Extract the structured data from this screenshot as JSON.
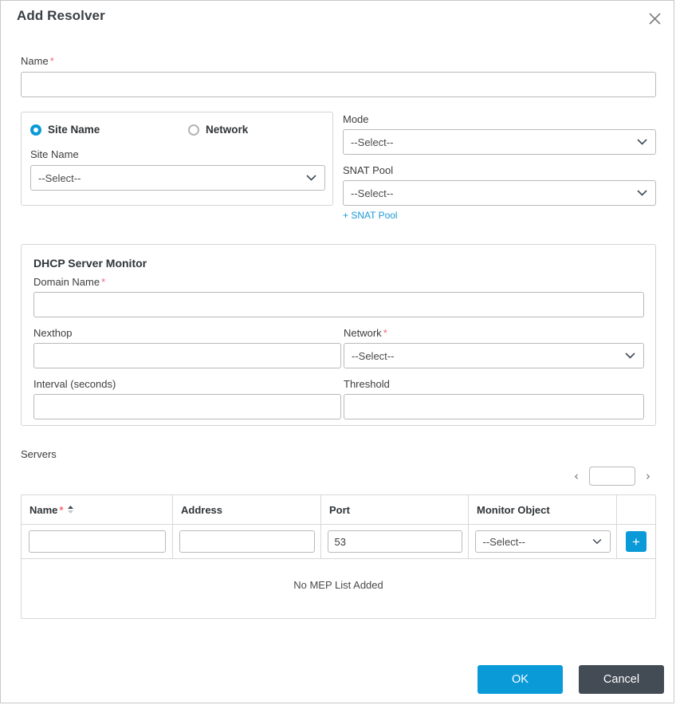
{
  "dialog": {
    "title": "Add Resolver",
    "close_icon": "close-icon"
  },
  "name_field": {
    "label": "Name",
    "required_mark": "*",
    "value": "",
    "placeholder": ""
  },
  "target_panel": {
    "radios": [
      {
        "label": "Site Name",
        "selected": true
      },
      {
        "label": "Network",
        "selected": false
      }
    ],
    "site_name": {
      "label": "Site Name",
      "value": "--Select--"
    }
  },
  "mode_section": {
    "mode": {
      "label": "Mode",
      "value": "--Select--"
    },
    "snat_pool": {
      "label": "SNAT Pool",
      "value": "--Select--"
    },
    "add_snat_link": "+ SNAT Pool"
  },
  "dhcp_monitor": {
    "title": "DHCP Server Monitor",
    "domain_name": {
      "label": "Domain Name",
      "required_mark": "*",
      "value": ""
    },
    "nexthop": {
      "label": "Nexthop",
      "value": ""
    },
    "network": {
      "label": "Network",
      "required_mark": "*",
      "value": "--Select--"
    },
    "interval": {
      "label": "Interval (seconds)",
      "value": ""
    },
    "threshold": {
      "label": "Threshold",
      "value": ""
    }
  },
  "servers": {
    "label": "Servers",
    "pager": {
      "prev_icon": "chevron-left-icon",
      "next_icon": "chevron-right-icon",
      "page_value": "",
      "page_placeholder": ""
    },
    "columns": [
      {
        "label": "Name",
        "required_mark": "*",
        "sortable": true
      },
      {
        "label": "Address",
        "required_mark": "",
        "sortable": false
      },
      {
        "label": "Port",
        "required_mark": "",
        "sortable": false
      },
      {
        "label": "Monitor Object",
        "required_mark": "",
        "sortable": false
      },
      {
        "label": "",
        "required_mark": "",
        "sortable": false
      }
    ],
    "new_row": {
      "name": "",
      "address": "",
      "port": "53",
      "monitor_object": "--Select--",
      "add_button_label": "+"
    },
    "empty_text": "No MEP List Added"
  },
  "footer": {
    "ok_label": "OK",
    "cancel_label": "Cancel"
  },
  "colors": {
    "accent_blue": "#0b9ad8",
    "link_blue": "#1b9ad6",
    "required_red": "#f2667a",
    "cancel_dark": "#434b55"
  }
}
